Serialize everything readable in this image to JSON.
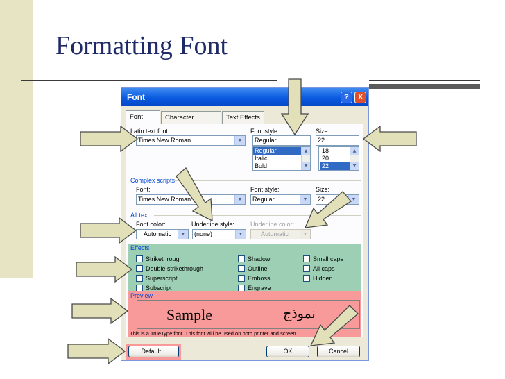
{
  "slide": {
    "title": "Formatting Font"
  },
  "dialog": {
    "title": "Font",
    "help_glyph": "?",
    "close_glyph": "X",
    "tabs": [
      {
        "label": "Font"
      },
      {
        "label": "Character Spacing"
      },
      {
        "label": "Text Effects"
      }
    ],
    "latin": {
      "font_label": "Latin text font:",
      "font_value": "Times New Roman",
      "style_label": "Font style:",
      "style_value": "Regular",
      "style_options": [
        "Regular",
        "Italic",
        "Bold"
      ],
      "style_selected": "Regular",
      "size_label": "Size:",
      "size_value": "22",
      "size_options": [
        "18",
        "20",
        "22"
      ],
      "size_selected": "22"
    },
    "complex": {
      "section_label": "Complex scripts",
      "font_label": "Font:",
      "font_value": "Times New Roman",
      "style_label": "Font style:",
      "style_value": "Regular",
      "size_label": "Size:",
      "size_value": "22"
    },
    "alltext": {
      "section_label": "All text",
      "color_label": "Font color:",
      "color_value": "Automatic",
      "underline_label": "Underline style:",
      "underline_value": "(none)",
      "underline_color_label": "Underline color:",
      "underline_color_value": "Automatic"
    },
    "effects": {
      "section_label": "Effects",
      "items": [
        "Strikethrough",
        "Double strikethrough",
        "Superscript",
        "Subscript",
        "Shadow",
        "Outline",
        "Emboss",
        "Engrave",
        "Small caps",
        "All caps",
        "Hidden"
      ]
    },
    "preview": {
      "section_label": "Preview",
      "sample_latin": "Sample",
      "sample_arabic": "نموذج",
      "note": "This is a TrueType font. This font will be used on both printer and screen."
    },
    "buttons": {
      "default": "Default...",
      "ok": "OK",
      "cancel": "Cancel"
    }
  },
  "colors": {
    "title": "#1f2a66",
    "effects_highlight": "#9ccfb3",
    "preview_highlight": "#f99a9a",
    "arrow_fill": "#e2e0b8",
    "arrow_stroke": "#4a4a4a",
    "titlebar": "#0a5ae0"
  }
}
